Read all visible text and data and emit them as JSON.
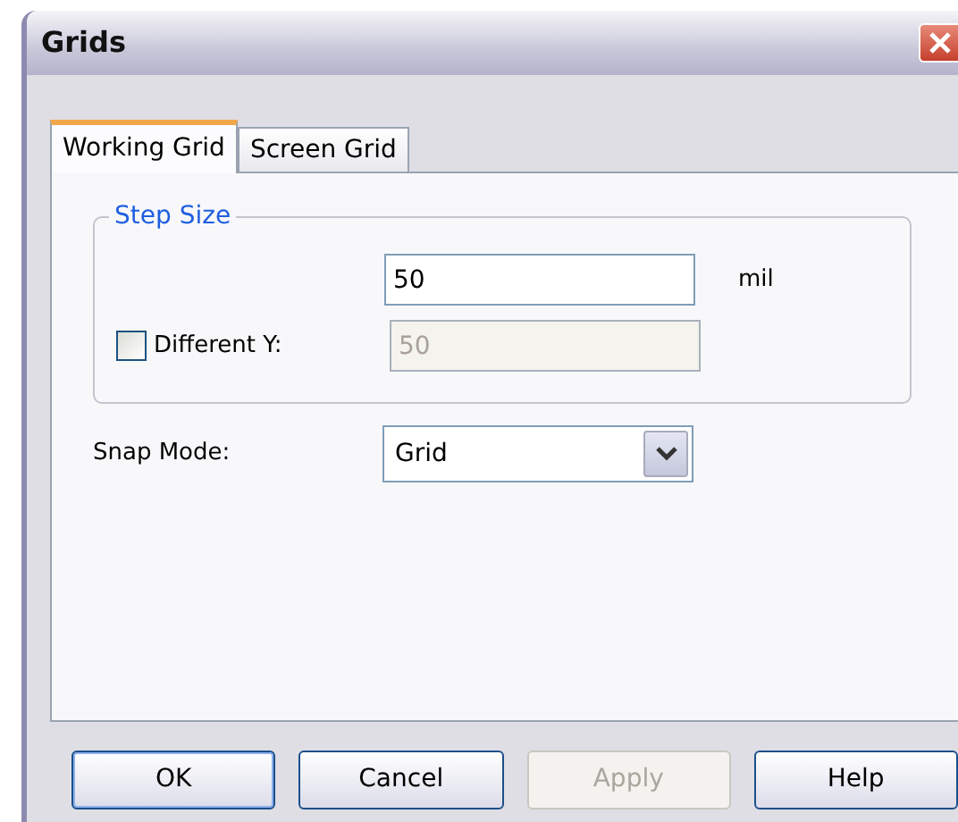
{
  "window": {
    "title": "Grids"
  },
  "tabs": [
    {
      "label": "Working Grid",
      "selected": true
    },
    {
      "label": "Screen Grid",
      "selected": false
    }
  ],
  "step_size": {
    "title": "Step Size",
    "value": "50",
    "unit": "mil",
    "different_y": {
      "label": "Different Y:",
      "checked": false,
      "value": "50",
      "disabled": true
    }
  },
  "snap_mode": {
    "label": "Snap Mode:",
    "value": "Grid"
  },
  "buttons": [
    {
      "label": "OK",
      "disabled": false,
      "default": true
    },
    {
      "label": "Cancel",
      "disabled": false,
      "default": false
    },
    {
      "label": "Apply",
      "disabled": true,
      "default": false
    },
    {
      "label": "Help",
      "disabled": false,
      "default": false
    }
  ]
}
